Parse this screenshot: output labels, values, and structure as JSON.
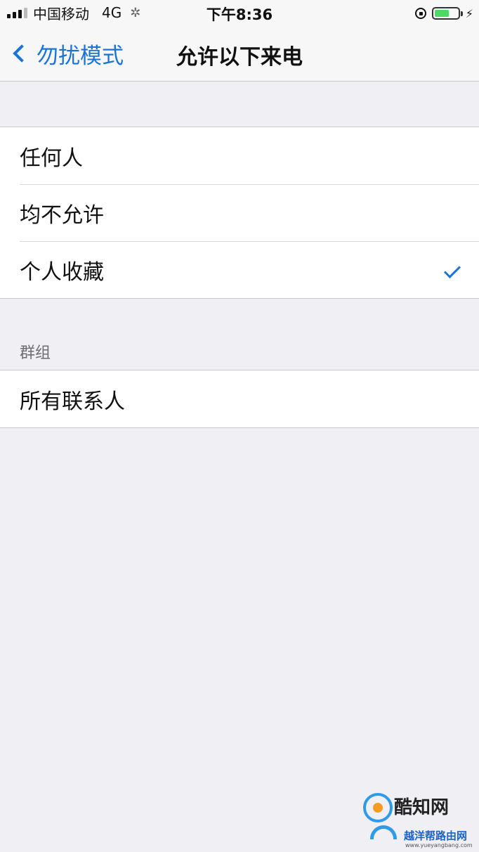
{
  "status_bar": {
    "carrier": "中国移动",
    "network": "4G",
    "time": "下午8:36"
  },
  "nav": {
    "back_label": "勿扰模式",
    "title": "允许以下来电"
  },
  "options": [
    {
      "label": "任何人",
      "selected": false
    },
    {
      "label": "均不允许",
      "selected": false
    },
    {
      "label": "个人收藏",
      "selected": true
    }
  ],
  "groups_section": {
    "header": "群组",
    "items": [
      {
        "label": "所有联系人"
      }
    ]
  },
  "watermark": {
    "top_text": "酷知网",
    "bottom_text": "越洋帮路由网",
    "url": "www.yueyangbang.com"
  },
  "colors": {
    "accent": "#1b73d8",
    "background": "#efeff4",
    "battery": "#4cd964"
  }
}
